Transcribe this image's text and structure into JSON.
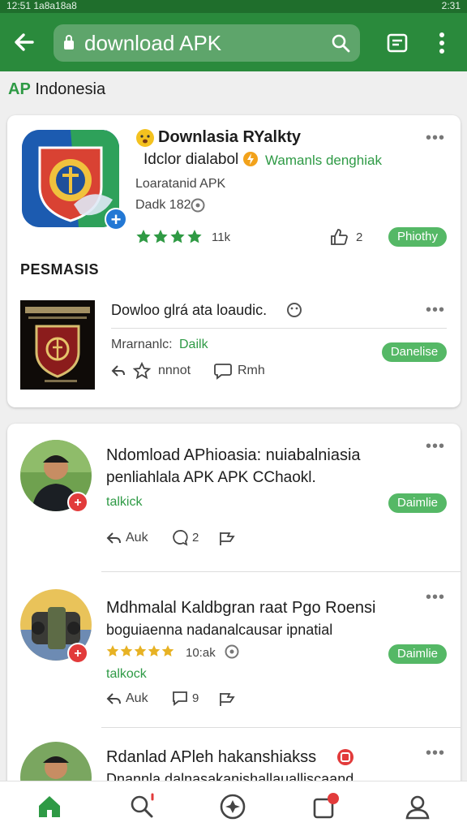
{
  "status_bar": {
    "left": "12:51 1a8a18a8",
    "right": "2:31"
  },
  "toolbar": {
    "search_query": "download APK"
  },
  "region": {
    "prefix": "AP",
    "label": "Indonesia"
  },
  "colors": {
    "appbar": "#2a8a3c",
    "accent": "#2e9a45",
    "pill": "#55b866",
    "badge_red": "#e23b3b"
  },
  "featured": {
    "title": "Downlasia RYalkty",
    "subtitle": "Idclor dialabol",
    "subtitle_green": "Wamanls denghiak",
    "meta1": "Loaratanid APK",
    "meta2": "Dadk 182",
    "rating_stars": 4,
    "rating_text": "11k",
    "likes": "2",
    "action": "Phiothy",
    "section": "PESMASIS",
    "sub_title": "Dowloo glrá ata loaudic.",
    "sub_meta": "Mrarnanlc:",
    "sub_meta_green": "Dailk",
    "sub_action": "Danelise",
    "sub_share": "nnnot",
    "sub_comment": "Rmh"
  },
  "posts": [
    {
      "title1": "Ndomload APhioasia: nuiabalniasia",
      "title2": "penliahlala APK APK CChaokl.",
      "tag": "talkick",
      "action": "Daimlie",
      "reply": "Auk",
      "comments": "2"
    },
    {
      "title1": "Mdhmalal Kaldbgran raat Pgo Roensi",
      "title2": "boguiaenna nadanalcausar ipnatial",
      "rating_stars": 5,
      "rating_text": "10:ak",
      "tag": "talkock",
      "action": "Daimlie",
      "reply": "Auk",
      "comments": "9"
    },
    {
      "title1": "Rdanlad APleh hakanshiakss",
      "title2": "Dnannla dalnasakanishallaualliscaand"
    }
  ],
  "nav": {
    "items": [
      "home-icon",
      "search-icon",
      "explore-icon",
      "notifications-icon",
      "profile-icon"
    ]
  }
}
